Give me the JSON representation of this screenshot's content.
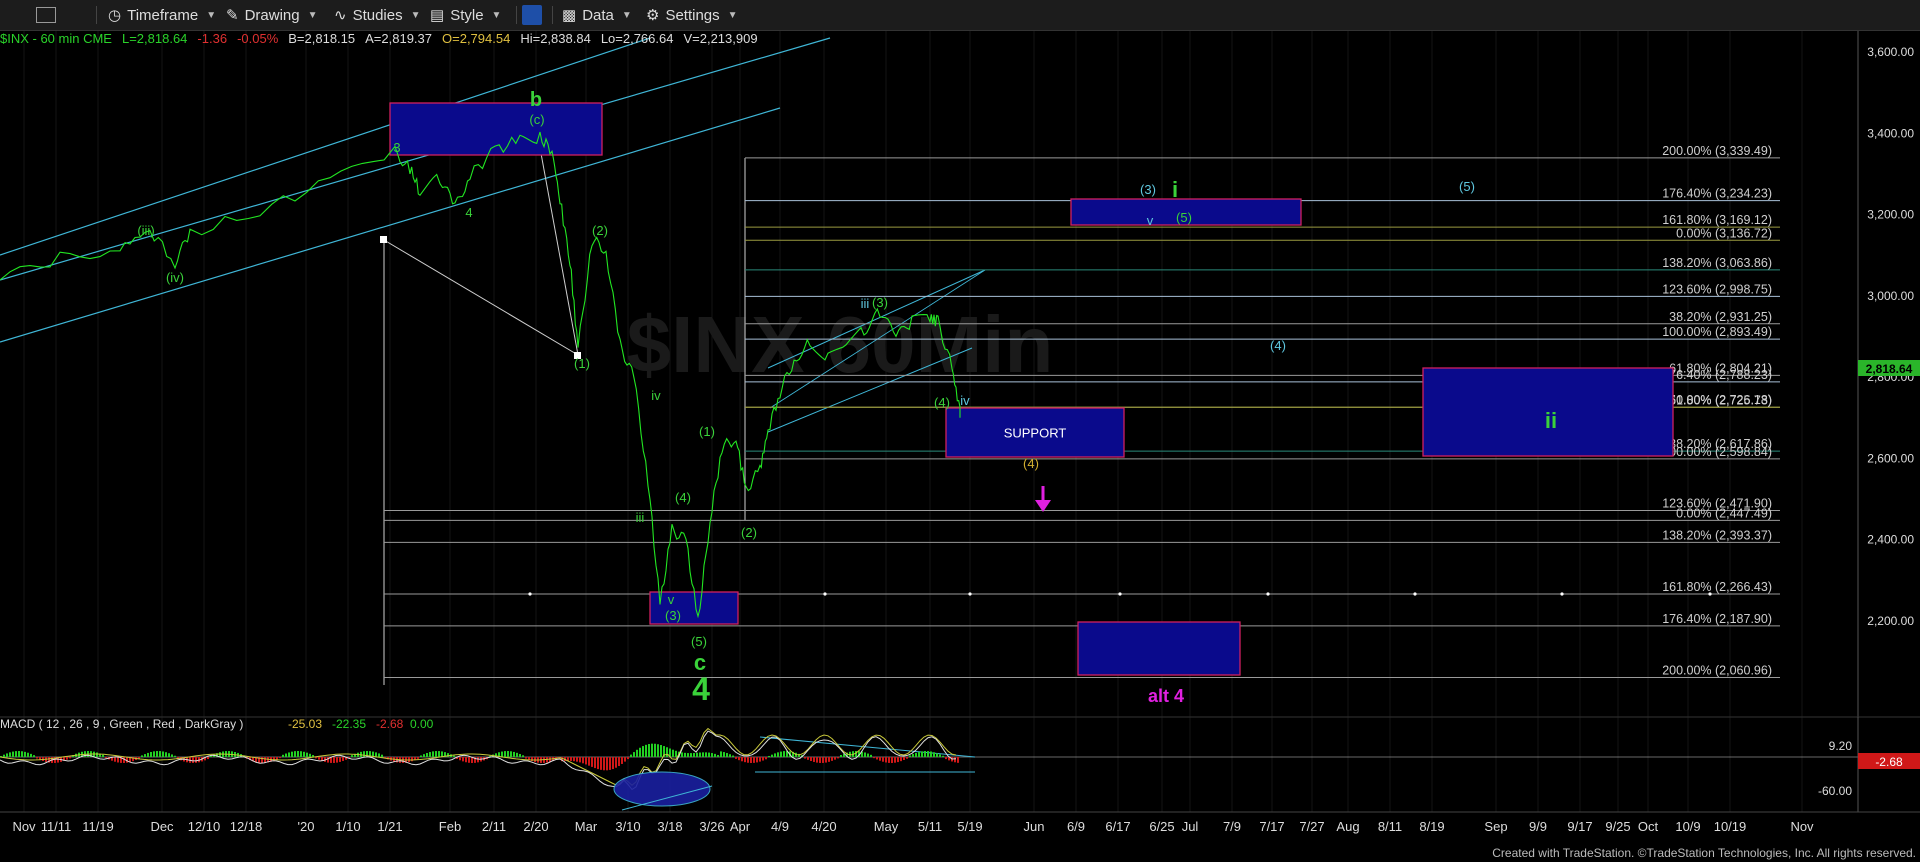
{
  "toolbar": {
    "items": [
      "Timeframe",
      "Drawing",
      "Studies",
      "Style",
      "Data",
      "Settings"
    ]
  },
  "info": {
    "symbol": "$INX - 60 min  CME",
    "last": "L=2,818.64",
    "chg": "-1.36",
    "pct": "-0.05%",
    "bid": "B=2,818.15",
    "ask": "A=2,819.37",
    "open": "O=2,794.54",
    "hi": "Hi=2,838.84",
    "lo": "Lo=2,766.64",
    "vol": "V=2,213,909"
  },
  "chart_data": {
    "type": "line",
    "watermark": "$INX 60Min",
    "price_axis": {
      "ylim": [
        1968,
        3668
      ],
      "ticks": [
        "3,600.00",
        "3,400.00",
        "3,200.00",
        "3,000.00",
        "2,800.00",
        "2,600.00",
        "2,400.00",
        "2,200.00"
      ],
      "tick_values": [
        3600,
        3400,
        3200,
        3000,
        2800,
        2600,
        2400,
        2200
      ],
      "last_price": "2,818.64"
    },
    "time_axis": {
      "labels": [
        "Nov",
        "11/11",
        "11/19",
        "Dec",
        "12/10",
        "12/18",
        "'20",
        "1/10",
        "1/21",
        "Feb",
        "2/11",
        "2/20",
        "Mar",
        "3/10",
        "3/18",
        "3/26",
        "Apr",
        "4/9",
        "4/20",
        "May",
        "5/11",
        "5/19",
        "Jun",
        "6/9",
        "6/17",
        "6/25",
        "Jul",
        "7/9",
        "7/17",
        "7/27",
        "Aug",
        "8/11",
        "8/19",
        "Sep",
        "9/9",
        "9/17",
        "9/25",
        "Oct",
        "10/9",
        "10/19",
        "Nov"
      ]
    },
    "fib_levels": [
      {
        "label": "200.00% (3,339.49)",
        "value": 3339.49,
        "color": "#9a9a9a"
      },
      {
        "label": "176.40% (3,234.23)",
        "value": 3234.23,
        "color": "#a8c0d8"
      },
      {
        "label": "161.80% (3,169.12)",
        "value": 3169.12,
        "color": "#9a9a40"
      },
      {
        "label": "0.00% (3,136.72)",
        "value": 3136.72,
        "color": "#9a9a40"
      },
      {
        "label": "138.20% (3,063.86)",
        "value": 3063.86,
        "color": "#2a8a7a"
      },
      {
        "label": "123.60% (2,998.75)",
        "value": 2998.75,
        "color": "#a8c0d8"
      },
      {
        "label": "38.20% (2,931.25)",
        "value": 2931.25,
        "color": "#9a9a9a"
      },
      {
        "label": "100.00% (2,893.49)",
        "value": 2893.49,
        "color": "#a8c0d8"
      },
      {
        "label": "61.80% (2,804.21)",
        "value": 2804.21,
        "color": "#9a9a9a"
      },
      {
        "label": "76.40% (2,788.23)",
        "value": 2788.23,
        "color": "#a8c0d8"
      },
      {
        "label": "50.00% (2,726.18)",
        "value": 2726.18,
        "color": "#9a9a40"
      },
      {
        "label": "61.80% (2,725.73)",
        "value": 2725.73,
        "color": "#9a9a40"
      },
      {
        "label": "38.20% (2,617.86)",
        "value": 2617.86,
        "color": "#2a8a7a"
      },
      {
        "label": "100.00% (2,598.84)",
        "value": 2598.84,
        "color": "#9a9a9a"
      },
      {
        "label": "123.60% (2,471.90)",
        "value": 2471.9,
        "color": "#9a9a9a"
      },
      {
        "label": "0.00% (2,447.49)",
        "value": 2447.49,
        "color": "#9a9a9a"
      },
      {
        "label": "138.20% (2,393.37)",
        "value": 2393.37,
        "color": "#9a9a9a"
      },
      {
        "label": "161.80% (2,266.43)",
        "value": 2266.43,
        "color": "#9a9a9a"
      },
      {
        "label": "176.40% (2,187.90)",
        "value": 2187.9,
        "color": "#9a9a9a"
      },
      {
        "label": "200.00% (2,060.96)",
        "value": 2060.96,
        "color": "#9a9a9a"
      }
    ],
    "boxes": [
      {
        "label": "",
        "x0": "1/21",
        "x1": "2/26",
        "y0": 3352,
        "y1": 3478
      },
      {
        "label": "",
        "x0": "3/13",
        "x1": "3/26",
        "y0": 2200,
        "y1": 2275
      },
      {
        "label": "SUPPORT",
        "x0": "5/13",
        "x1": "6/4",
        "y0": 2605,
        "y1": 2718
      },
      {
        "label": "",
        "x0": "6/23",
        "x1": "7/22",
        "y0": 3176,
        "y1": 3237
      },
      {
        "label": "",
        "x0": "8/20",
        "x1": "10/6",
        "y0": 2602,
        "y1": 2820
      },
      {
        "label": "",
        "x0": "6/24",
        "x1": "7/14",
        "y0": 2065,
        "y1": 2194
      }
    ],
    "wave_labels": [
      {
        "text": "b",
        "color": "#3ad23a",
        "big": true
      },
      {
        "text": "(c)",
        "color": "#3ad23a"
      },
      {
        "text": "3",
        "color": "#3ad23a"
      },
      {
        "text": "4",
        "color": "#3ad23a"
      },
      {
        "text": "(iii)",
        "color": "#3ad23a"
      },
      {
        "text": "(iv)",
        "color": "#3ad23a"
      },
      {
        "text": "(2)",
        "color": "#3ad23a"
      },
      {
        "text": "(1)",
        "color": "#3ad23a"
      },
      {
        "text": "iv",
        "color": "#3ad23a"
      },
      {
        "text": "iii",
        "color": "#3ad23a"
      },
      {
        "text": "(4)",
        "color": "#3ad23a"
      },
      {
        "text": "(1)",
        "color": "#3ad23a"
      },
      {
        "text": "(2)",
        "color": "#3ad23a"
      },
      {
        "text": "v",
        "color": "#3ad23a"
      },
      {
        "text": "(3)",
        "color": "#3ad23a"
      },
      {
        "text": "(5)",
        "color": "#3ad23a"
      },
      {
        "text": "c",
        "color": "#3ad23a",
        "big": true
      },
      {
        "text": "4",
        "color": "#3ad23a",
        "big": true
      },
      {
        "text": "iii",
        "color": "#5fc8e0"
      },
      {
        "text": "(3)",
        "color": "#3ad23a"
      },
      {
        "text": "(4)",
        "color": "#3ad23a"
      },
      {
        "text": "iv",
        "color": "#5fc8e0"
      },
      {
        "text": "(3)",
        "color": "#5fc8e0"
      },
      {
        "text": "i",
        "color": "#3ad23a",
        "big": true
      },
      {
        "text": "v",
        "color": "#5fc8e0"
      },
      {
        "text": "(5)",
        "color": "#3ad23a"
      },
      {
        "text": "(5)",
        "color": "#5fc8e0"
      },
      {
        "text": "(4)",
        "color": "#5fc8e0"
      },
      {
        "text": "ii",
        "color": "#3ad23a",
        "big": true
      },
      {
        "text": "(4)",
        "color": "#d4b030"
      },
      {
        "text": "alt 4",
        "color": "#e020e0",
        "big": true
      }
    ],
    "macd": {
      "legend": "MACD ( 12 , 26 , 9 , Green , Red , DarkGray )",
      "v1": "-25.03",
      "v2": "-22.35",
      "v3": "-2.68",
      "v4": "0.00",
      "ticks": [
        "9.20",
        "-60.00"
      ],
      "tick_values": [
        9.2,
        -60
      ],
      "last": "-2.68"
    }
  },
  "footer": "Created with TradeStation. ©TradeStation Technologies, Inc. All rights reserved."
}
